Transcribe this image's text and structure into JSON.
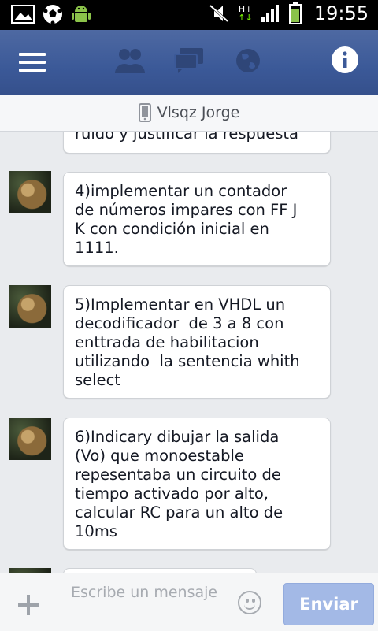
{
  "statusbar": {
    "time": "19:55",
    "network_label": "H+",
    "icons": [
      "image-icon",
      "soccer-ball-icon",
      "android-icon",
      "mute-icon",
      "signal-icon",
      "battery-icon"
    ]
  },
  "appbar": {
    "icons": [
      "menu-icon",
      "friends-icon",
      "messages-icon",
      "globe-icon",
      "info-icon"
    ],
    "brand_color": "#3b5998"
  },
  "contact": {
    "name": "Vlsqz Jorge",
    "icon": "phone-icon"
  },
  "messages": [
    {
      "text": "ruido y justificar la respuesta"
    },
    {
      "text": "4)implementar un contador\nde números impares con FF J\nK con condición inicial en\n1111."
    },
    {
      "text": "5)Implementar en VHDL un\ndecodificador  de 3 a 8 con\nenttrada de habilitacion\nutilizando  la sentencia whith\nselect"
    },
    {
      "text": "6)Indicary dibujar la salida\n(Vo) que monoestable\nrepesentaba un circuito de\ntiempo activado por alto,\ncalcular RC para un alto de\n10ms"
    }
  ],
  "compose": {
    "placeholder": "Escribe un mensaje",
    "send_label": "Enviar"
  }
}
